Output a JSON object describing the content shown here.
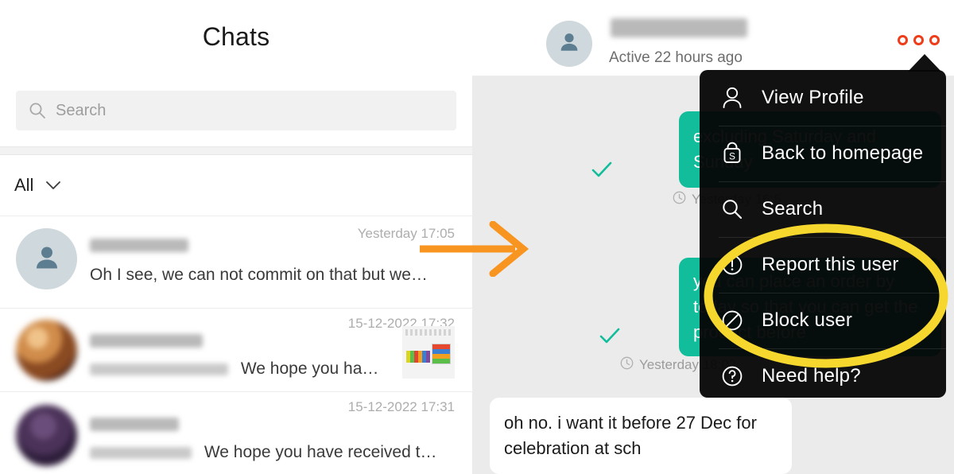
{
  "app": {
    "accent_green": "#11bd9a",
    "accent_orange": "#f79520",
    "accent_red": "#ef3d1a",
    "highlight_yellow": "#f5d72e",
    "menu_bg": "#060606"
  },
  "chat_list": {
    "title": "Chats",
    "search": {
      "placeholder": "Search",
      "value": "",
      "icon": "search-icon"
    },
    "filter": {
      "label": "All",
      "icon": "chevron-down-icon"
    },
    "items": [
      {
        "name": "",
        "name_redacted": true,
        "preview": "Oh I see, we can not commit on that but we…",
        "preview_redacted_prefix": "",
        "time": "Yesterday 17:05",
        "avatar": "default-person-avatar",
        "thumbnail": false
      },
      {
        "name": "",
        "name_redacted": true,
        "preview": "We hope you ha…",
        "preview_redacted_prefix": "",
        "time": "15-12-2022 17:32",
        "avatar": "photo-avatar-orange",
        "thumbnail": true
      },
      {
        "name": "",
        "name_redacted": true,
        "preview": "We hope you have received t…",
        "preview_redacted_prefix": "",
        "time": "15-12-2022 17:31",
        "avatar": "photo-avatar-purple",
        "thumbnail": false
      }
    ]
  },
  "conversation": {
    "header": {
      "username": "",
      "username_redacted": true,
      "status": "Active 22 hours ago",
      "avatar": "default-person-avatar",
      "kebab_icon": "more-options-icon"
    },
    "messages": [
      {
        "side": "outgoing",
        "text": "excluding Saturday and Sunday",
        "status_icon": "sent-check-icon",
        "meta_icon": "clock-icon",
        "meta": "Yesterday 16:5"
      },
      {
        "side": "outgoing",
        "text": "you can place an order by today so that you can get the product before",
        "status_icon": "sent-check-icon",
        "meta_icon": "clock-icon",
        "meta": "Yesterday 18:02"
      },
      {
        "side": "incoming",
        "text": "oh no. i want it before 27 Dec for celebration at sch",
        "status_icon": "",
        "meta_icon": "",
        "meta": ""
      }
    ]
  },
  "context_menu": {
    "items": [
      {
        "label": "View Profile",
        "icon": "person-outline-icon"
      },
      {
        "label": "Back to homepage",
        "icon": "shop-bag-icon"
      },
      {
        "label": "Search",
        "icon": "search-icon"
      },
      {
        "label": "Report this user",
        "icon": "exclamation-circle-icon"
      },
      {
        "label": "Block user",
        "icon": "block-circle-icon"
      },
      {
        "label": "Need help?",
        "icon": "question-circle-icon"
      }
    ]
  },
  "annotations": {
    "arrow": {
      "name": "orange-pointer-arrow",
      "color": "#f79520"
    },
    "ellipse": {
      "name": "yellow-highlight-ellipse",
      "color": "#f5d72e"
    }
  }
}
